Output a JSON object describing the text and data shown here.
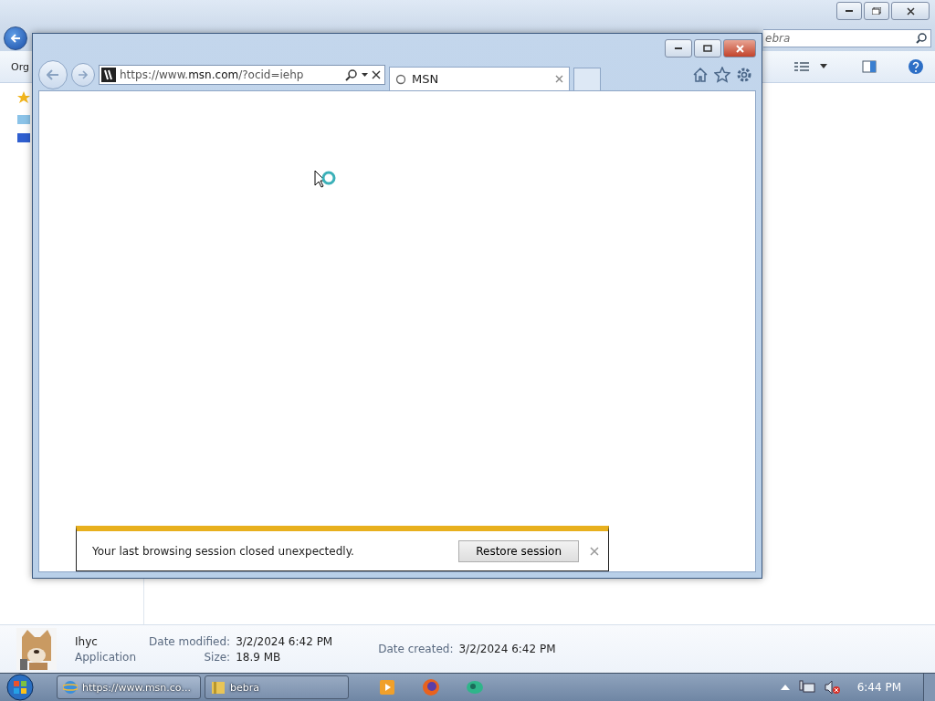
{
  "explorer": {
    "toolbar_item": "Org",
    "search": {
      "placeholder": "ebra"
    },
    "details": {
      "name": "Ihyc",
      "type": "Application",
      "columns": [
        [
          {
            "label": "Date modified:",
            "value": "3/2/2024 6:42 PM"
          },
          {
            "label": "Size:",
            "value": "18.9 MB"
          }
        ],
        [
          {
            "label": "Date created:",
            "value": "3/2/2024 6:42 PM"
          }
        ]
      ]
    }
  },
  "browser": {
    "address": "https://www.**msn.com**/?ocid=iehp",
    "tabs": [
      {
        "label": "MSN",
        "selected": true,
        "loading": true
      }
    ],
    "notification": {
      "message": "Your last browsing session closed unexpectedly.",
      "button": "Restore session"
    }
  },
  "taskbar": {
    "windows": [
      {
        "label": "https://www.msn.co...",
        "kind": "browser",
        "selected": true
      },
      {
        "label": "bebra",
        "kind": "folder",
        "selected": false
      }
    ],
    "pinned": [
      {
        "kind": "media"
      },
      {
        "kind": "firefox"
      },
      {
        "kind": "chat"
      }
    ],
    "clock": "6:44 PM"
  }
}
